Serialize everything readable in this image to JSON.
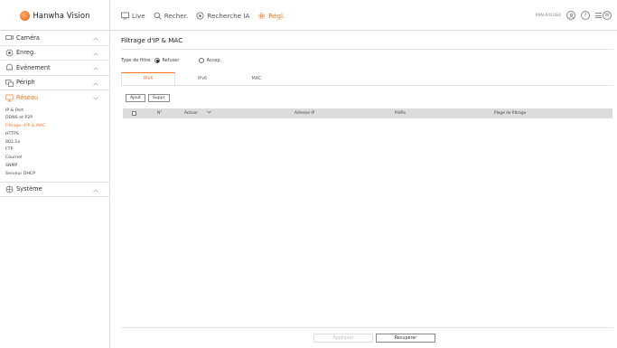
{
  "brand": {
    "name": "Hanwha Vision",
    "accent": "#f37321"
  },
  "nav": [
    {
      "label": "Live",
      "icon": "monitor-icon",
      "active": false
    },
    {
      "label": "Recher.",
      "icon": "search-icon",
      "active": false
    },
    {
      "label": "Recherche IA",
      "icon": "ai-search-icon",
      "active": false
    },
    {
      "label": "Régl.",
      "icon": "gear-icon",
      "active": true
    }
  ],
  "header_right": {
    "user_id": "99N-641084",
    "help": "?",
    "menu_badge": "W"
  },
  "sidebar": {
    "categories": [
      {
        "label": "Caméra",
        "icon": "camera-icon"
      },
      {
        "label": "Enreg.",
        "icon": "record-icon"
      },
      {
        "label": "Événement",
        "icon": "bell-icon"
      },
      {
        "label": "Périph",
        "icon": "device-icon"
      },
      {
        "label": "Réseau",
        "icon": "network-icon"
      },
      {
        "label": "Système",
        "icon": "system-icon"
      }
    ],
    "network_items": [
      "IP & Port",
      "DDNS et P2P",
      "Filtrage d'IP & MAC",
      "HTTPS",
      "802.1x",
      "FTP",
      "Courriel",
      "SNMP",
      "Serveur DHCP"
    ]
  },
  "main": {
    "title": "Filtrage d'IP & MAC",
    "filter_type_label": "Type de filtre",
    "options": [
      "Refuser",
      "Accep."
    ],
    "selected_option": "Refuser",
    "tabs": [
      "IPv4",
      "IPv6",
      "MAC"
    ],
    "active_tab": "IPv4",
    "add_label": "Ajout",
    "delete_label": "Suppr",
    "table_headers": [
      "N°",
      "Activer",
      "Adresse IP",
      "Préfix",
      "Plage de filtrage"
    ],
    "apply_label": "Appliquer",
    "retrieve_label": "Récupérer"
  }
}
